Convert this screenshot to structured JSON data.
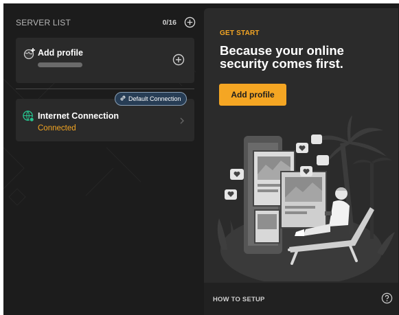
{
  "server_list": {
    "title": "SERVER LIST",
    "count": "0/16"
  },
  "add_profile_card": {
    "title": "Add profile"
  },
  "connection_card": {
    "badge": "Default Connection",
    "title": "Internet Connection",
    "status": "Connected"
  },
  "promo": {
    "eyebrow": "GET START",
    "headline": "Because your online security comes first.",
    "button_label": "Add profile"
  },
  "footer": {
    "how_to": "HOW TO SETUP"
  },
  "icons": {
    "header_add": "plus-circle-icon",
    "profile_globe": "globe-plus-icon",
    "profile_add": "plus-circle-icon",
    "badge_link": "link-icon",
    "connection_globe": "globe-icon",
    "connection_chevron": "chevron-right-icon",
    "help": "question-circle-icon"
  },
  "colors": {
    "accent": "#f5a623",
    "background": "#1c1c1c",
    "card": "#2a2a2a",
    "panel": "#2b2b2b",
    "status_online": "#27c28e"
  }
}
